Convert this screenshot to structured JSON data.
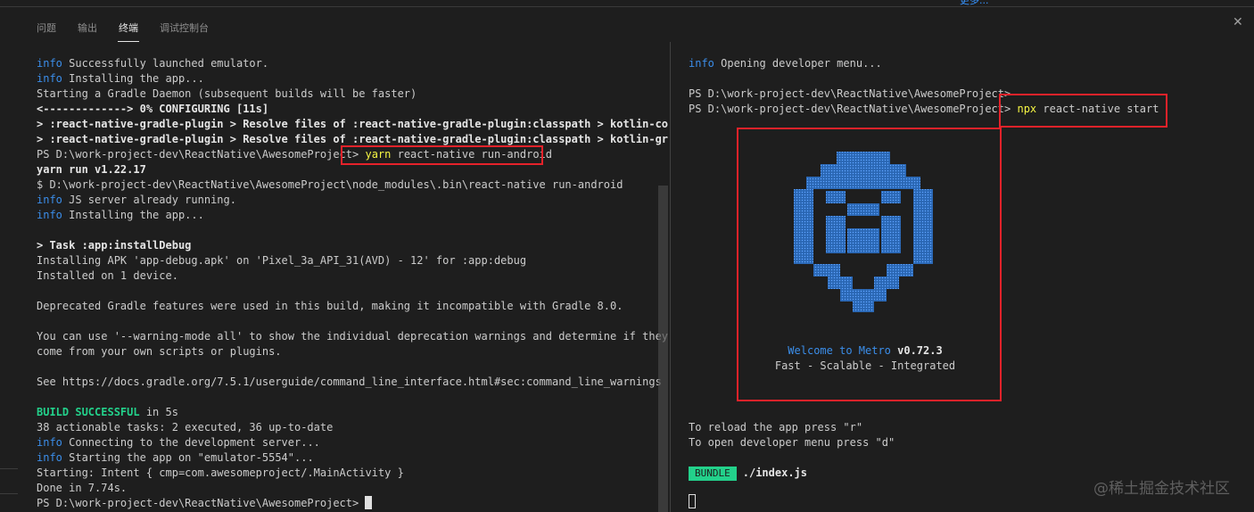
{
  "top_link": "更多...",
  "tabs": [
    {
      "label": "问题"
    },
    {
      "label": "输出"
    },
    {
      "label": "终端",
      "active": true
    },
    {
      "label": "调试控制台"
    }
  ],
  "left_terminal": {
    "l1_info": "info",
    "l1": " Successfully launched emulator.",
    "l2_info": "info",
    "l2": " Installing the app...",
    "l3": "Starting a Gradle Daemon (subsequent builds will be faster)",
    "l4": "<-------------> 0% CONFIGURING [11s]",
    "l5": "> :react-native-gradle-plugin > Resolve files of :react-native-gradle-plugin:classpath > kotlin-co",
    "l6": "> :react-native-gradle-plugin > Resolve files of :react-native-gradle-plugin:classpath > kotlin-gr",
    "l7_prompt": "PS D:\\work-project-dev\\ReactNative\\AwesomeProject> ",
    "l7_cmd": "yarn",
    "l7_args": " react-native run-android",
    "l8": "yarn run v1.22.17",
    "l9": "$ D:\\work-project-dev\\ReactNative\\AwesomeProject\\node_modules\\.bin\\react-native run-android",
    "l10_info": "info",
    "l10": " JS server already running.",
    "l11_info": "info",
    "l11": " Installing the app...",
    "l12": "> Task :app:installDebug",
    "l13": "Installing APK 'app-debug.apk' on 'Pixel_3a_API_31(AVD) - 12' for :app:debug",
    "l14": "Installed on 1 device.",
    "l15": "Deprecated Gradle features were used in this build, making it incompatible with Gradle 8.0.",
    "l16": "You can use '--warning-mode all' to show the individual deprecation warnings and determine if they",
    "l17": "come from your own scripts or plugins.",
    "l18": "See https://docs.gradle.org/7.5.1/userguide/command_line_interface.html#sec:command_line_warnings",
    "l19_ok": "BUILD SUCCESSFUL",
    "l19": " in 5s",
    "l20": "38 actionable tasks: 2 executed, 36 up-to-date",
    "l21_info": "info",
    "l21": " Connecting to the development server...",
    "l22_info": "info",
    "l22": " Starting the app on \"emulator-5554\"...",
    "l23": "Starting: Intent { cmp=com.awesomeproject/.MainActivity }",
    "l24": "Done in 7.74s.",
    "l25_prompt": "PS D:\\work-project-dev\\ReactNative\\AwesomeProject> "
  },
  "right_terminal": {
    "r1_info": "info",
    "r1": " Opening developer menu...",
    "r2": "PS D:\\work-project-dev\\ReactNative\\AwesomeProject>",
    "r3_prompt": "PS D:\\work-project-dev\\ReactNative\\AwesomeProject> ",
    "r3_cmd": "npx",
    "r3_args": " react-native start",
    "welcome_a": "Welcome to Metro ",
    "welcome_b": "v0.72.3",
    "tagline": "Fast - Scalable - Integrated",
    "reload": "To reload the app press \"r\"",
    "devmenu": "To open developer menu press \"d\"",
    "bundle_tag": "BUNDLE",
    "bundle_path": "./index.js"
  },
  "colors": {
    "background": "#1e1e1e",
    "info_blue": "#3b8eea",
    "success_green": "#23d18b",
    "command_yellow": "#f5f543",
    "highlight_red": "#e5222a"
  },
  "watermark": "@稀土掘金技术社区"
}
